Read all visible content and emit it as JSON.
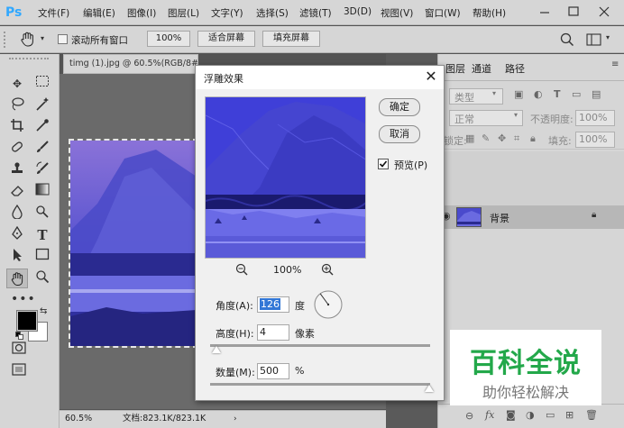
{
  "app": {
    "logo": "Ps"
  },
  "menu": [
    "文件(F)",
    "编辑(E)",
    "图像(I)",
    "图层(L)",
    "文字(Y)",
    "选择(S)",
    "滤镜(T)",
    "3D(D)",
    "视图(V)",
    "窗口(W)",
    "帮助(H)"
  ],
  "window_controls": {
    "minimize": "—",
    "maximize": "☐",
    "close": "✕"
  },
  "options_bar": {
    "scroll_all_label": "滚动所有窗口",
    "zoom_100": "100%",
    "fit_screen": "适合屏幕",
    "fill_screen": "填充屏幕"
  },
  "document": {
    "tab_title": "timg (1).jpg @ 60.5%(RGB/8#)",
    "zoom": "60.5%",
    "doc_info": "文档:823.1K/823.1K"
  },
  "layers_panel": {
    "tabs": [
      "图层",
      "通道",
      "路径"
    ],
    "filter_label": "类型",
    "blend_mode": "正常",
    "opacity_label": "不透明度:",
    "opacity_value": "100%",
    "lock_label": "锁定:",
    "fill_label": "填充:",
    "fill_value": "100%",
    "layer_name": "背景"
  },
  "dialog": {
    "title": "浮雕效果",
    "ok": "确定",
    "cancel": "取消",
    "preview_label": "预览(P)",
    "preview_checked": true,
    "zoom": "100%",
    "angle_label": "角度(A):",
    "angle_value": "126",
    "angle_unit": "度",
    "height_label": "高度(H):",
    "height_value": "4",
    "height_unit": "像素",
    "amount_label": "数量(M):",
    "amount_value": "500",
    "amount_unit": "%"
  },
  "watermark": {
    "title": "百科全说",
    "subtitle": "助你轻松解决"
  },
  "colors": {
    "accent": "#31a8ff",
    "watermark_green": "#23a84a",
    "image_blue": "#3f3fd8"
  }
}
